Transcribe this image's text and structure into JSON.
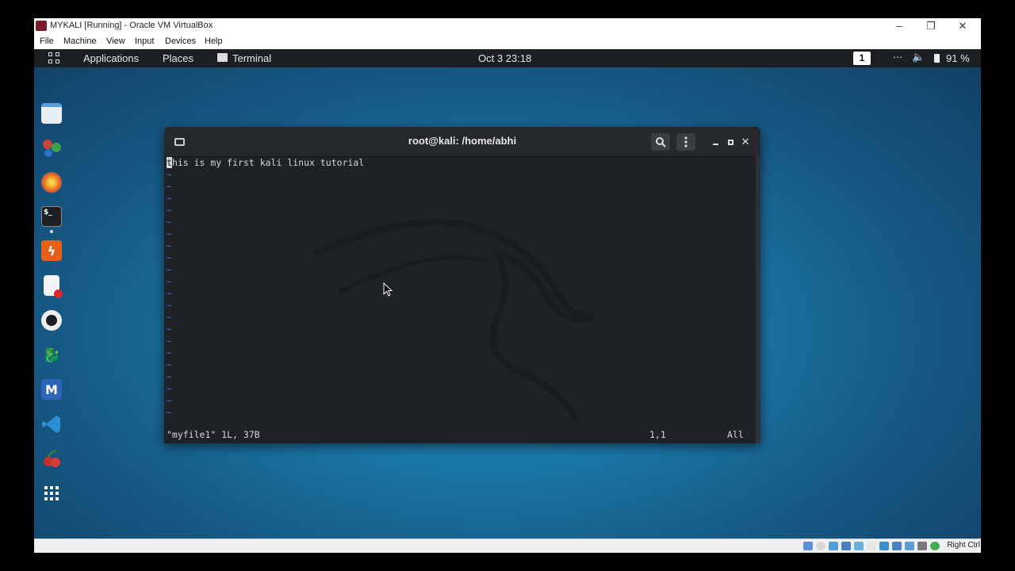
{
  "vbox": {
    "window_title": "MYKALI [Running] - Oracle VM VirtualBox",
    "menu": [
      "File",
      "Machine",
      "View",
      "Input",
      "Devices",
      "Help"
    ],
    "status_right_label": "Right Ctrl",
    "window_controls": {
      "minimize": "–",
      "restore": "❐",
      "close": "✕"
    }
  },
  "topbar": {
    "applications": "Applications",
    "places": "Places",
    "terminal": "Terminal",
    "datetime": "Oct 3  23:18",
    "workspace": "1",
    "battery": "91 %"
  },
  "dock": {
    "items": [
      {
        "name": "files",
        "color": "#e9eef3"
      },
      {
        "name": "kali-tools",
        "color": "#c7443a"
      },
      {
        "name": "firefox",
        "color": "#e56b1f"
      },
      {
        "name": "terminal",
        "color": "#222"
      },
      {
        "name": "burpsuite",
        "color": "#e8611a"
      },
      {
        "name": "text-editor",
        "color": "#f4f4f4"
      },
      {
        "name": "maltego",
        "color": "#eee"
      },
      {
        "name": "kali-dragon",
        "color": "#ddd"
      },
      {
        "name": "metasploit",
        "color": "#2e64b9"
      },
      {
        "name": "vscode",
        "color": "#2c8fd6"
      },
      {
        "name": "cherrytree",
        "color": "#c62f2f"
      },
      {
        "name": "show-apps",
        "color": "#ffffff"
      }
    ]
  },
  "terminal": {
    "title": "root@kali: /home/abhi",
    "first_char": "t",
    "first_line_rest": "his is my first kali linux tutorial",
    "tilde": "~",
    "status_file": "\"myfile1\" 1L, 37B",
    "status_position": "1,1",
    "status_scroll": "All"
  }
}
